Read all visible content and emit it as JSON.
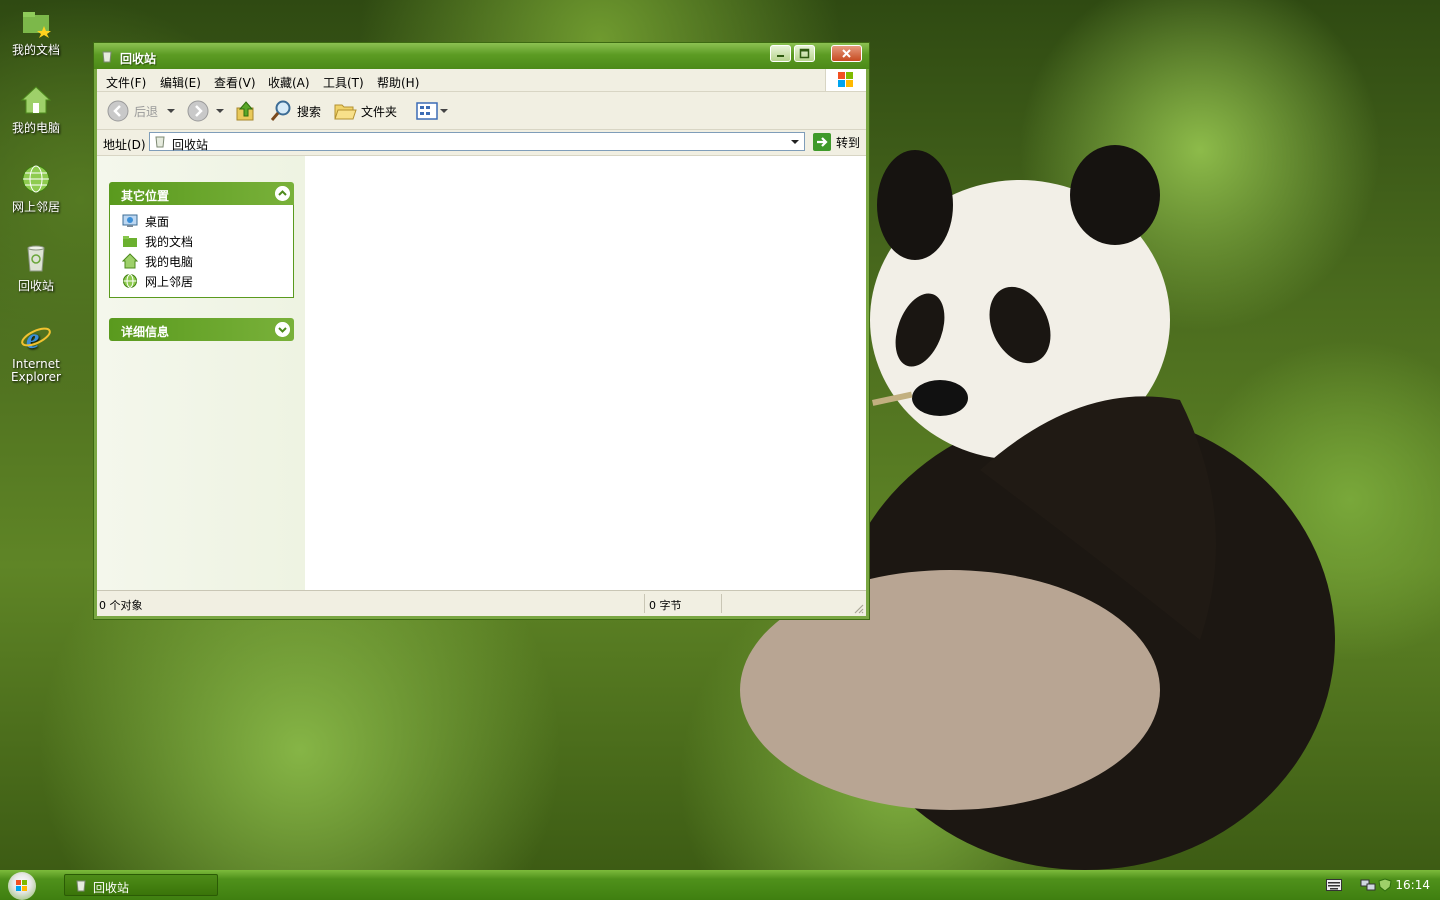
{
  "desktop": {
    "icons": [
      {
        "label": "我的文档",
        "icon": "my-documents-icon"
      },
      {
        "label": "我的电脑",
        "icon": "my-computer-icon"
      },
      {
        "label": "网上邻居",
        "icon": "network-places-icon"
      },
      {
        "label": "回收站",
        "icon": "recycle-bin-icon"
      },
      {
        "label_line1": "Internet",
        "label_line2": "Explorer",
        "icon": "internet-explorer-icon"
      }
    ]
  },
  "window": {
    "title": "回收站",
    "menu": [
      "文件(F)",
      "编辑(E)",
      "查看(V)",
      "收藏(A)",
      "工具(T)",
      "帮助(H)"
    ],
    "toolbar": {
      "back": "后退",
      "search": "搜索",
      "folders": "文件夹"
    },
    "address": {
      "label": "地址(D)",
      "value": "回收站",
      "go": "转到"
    },
    "task_panes": [
      {
        "title": "其它位置",
        "expanded": true,
        "links": [
          {
            "label": "桌面",
            "icon": "desktop-icon"
          },
          {
            "label": "我的文档",
            "icon": "my-documents-icon"
          },
          {
            "label": "我的电脑",
            "icon": "my-computer-icon"
          },
          {
            "label": "网上邻居",
            "icon": "network-places-icon"
          }
        ]
      },
      {
        "title": "详细信息",
        "expanded": false
      }
    ],
    "status": {
      "objects": "0 个对象",
      "size": "0 字节"
    }
  },
  "taskbar": {
    "task": "回收站",
    "clock": "16:14"
  },
  "colors": {
    "accent": "#5a9a1e",
    "taskbar": "#4f911b",
    "client": "#ffffff"
  }
}
